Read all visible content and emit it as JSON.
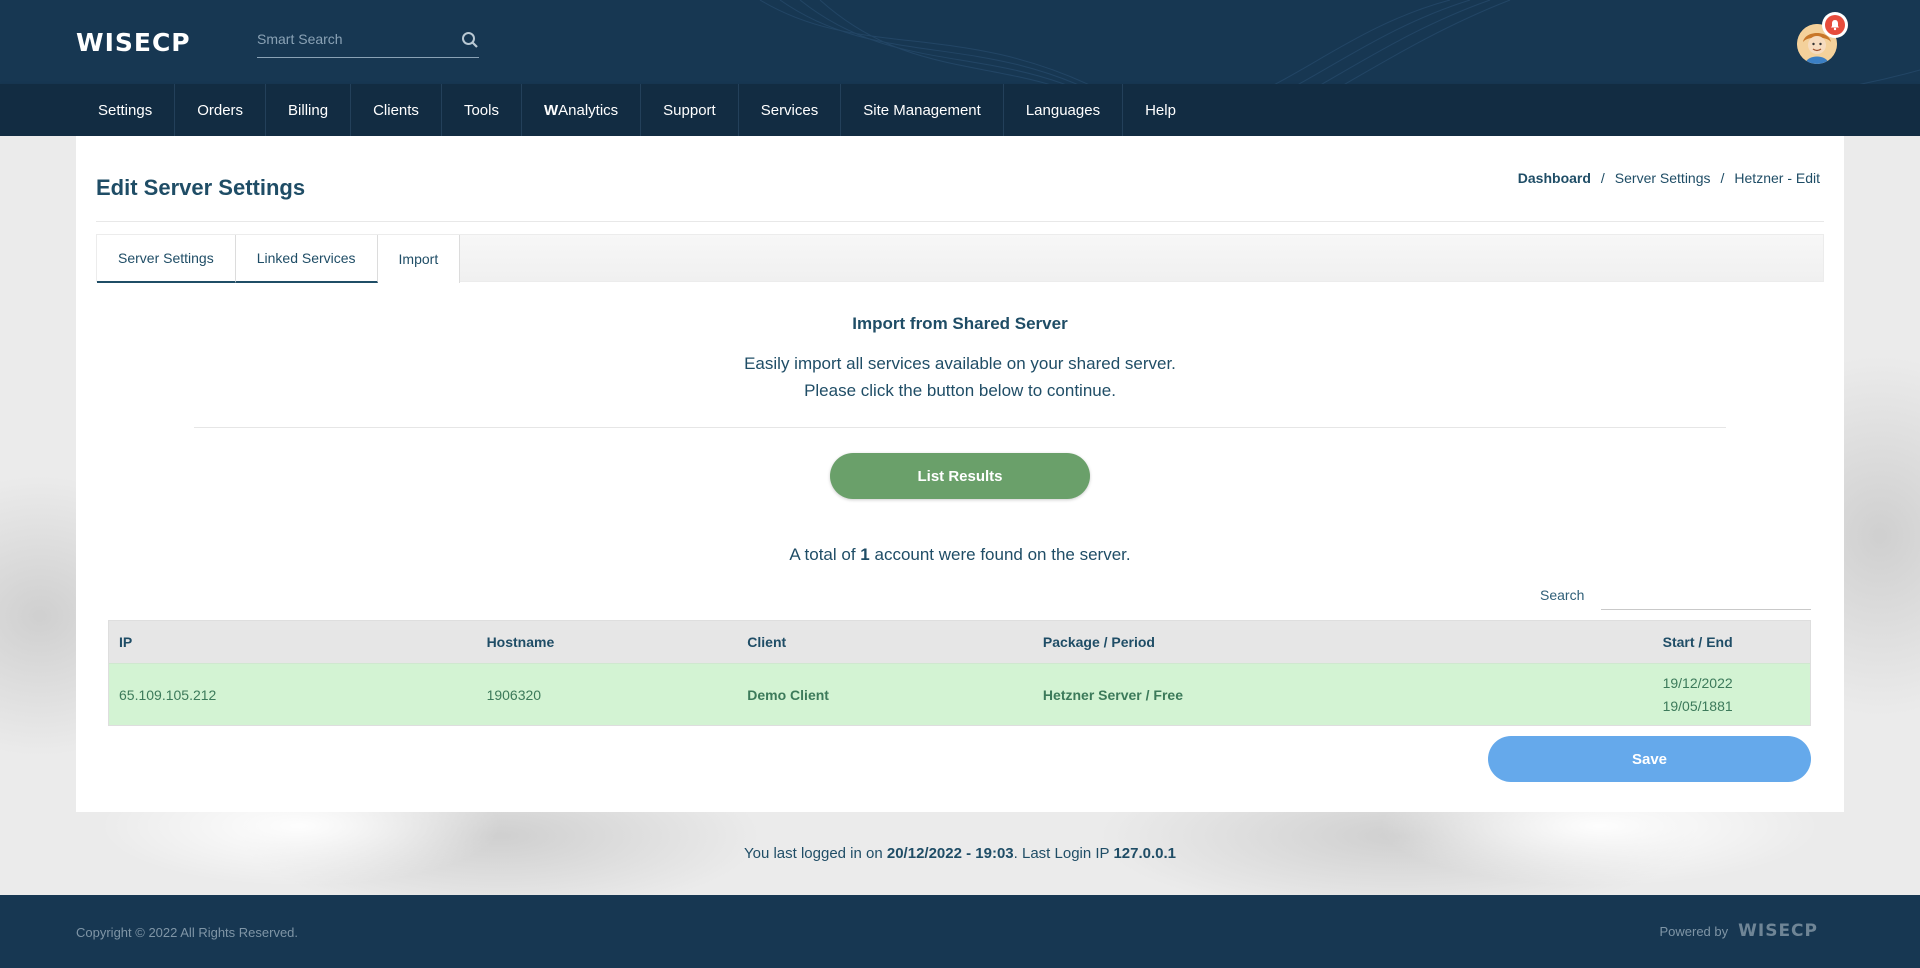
{
  "header": {
    "logo": "WISECP",
    "search_placeholder": "Smart Search"
  },
  "nav": {
    "items": [
      {
        "label": "Settings"
      },
      {
        "label": "Orders"
      },
      {
        "label": "Billing"
      },
      {
        "label": "Clients"
      },
      {
        "label": "Tools"
      },
      {
        "label_bold": "W",
        "label": "Analytics"
      },
      {
        "label": "Support"
      },
      {
        "label": "Services"
      },
      {
        "label": "Site Management"
      },
      {
        "label": "Languages"
      },
      {
        "label": "Help"
      }
    ]
  },
  "page": {
    "title": "Edit Server Settings",
    "breadcrumb": [
      "Dashboard",
      "Server Settings",
      "Hetzner - Edit"
    ],
    "breadcrumb_sep": "/"
  },
  "tabs": [
    {
      "label": "Server Settings"
    },
    {
      "label": "Linked Services"
    },
    {
      "label": "Import"
    }
  ],
  "import": {
    "title": "Import from Shared Server",
    "desc_line1": "Easily import all services available on your shared server.",
    "desc_line2": "Please click the button below to continue.",
    "list_button": "List Results",
    "total_prefix": "A total of ",
    "total_count": "1",
    "total_suffix": " account were found on the server."
  },
  "table": {
    "search_label": "Search",
    "columns": [
      "IP",
      "Hostname",
      "Client",
      "Package / Period",
      "Start / End"
    ],
    "rows": [
      {
        "ip": "65.109.105.212",
        "hostname": "1906320",
        "client": "Demo Client",
        "package": "Hetzner Server / Free",
        "start": "19/12/2022",
        "end": "19/05/1881"
      }
    ]
  },
  "save_button": "Save",
  "last_login": {
    "prefix": "You last logged in on ",
    "datetime": "20/12/2022 - 19:03",
    "middle": ". Last Login IP ",
    "ip": "127.0.0.1"
  },
  "footer": {
    "copyright": "Copyright © 2022 All Rights Reserved.",
    "powered_by": "Powered by",
    "logo": "WISECP"
  },
  "colors": {
    "header_bg": "#173752",
    "nav_bg": "#122c42",
    "primary_text": "#1f4d66",
    "list_button": "#6aa06a",
    "save_button": "#65a9eb",
    "row_highlight": "#d3f3d3",
    "notification": "#e74c3c"
  }
}
